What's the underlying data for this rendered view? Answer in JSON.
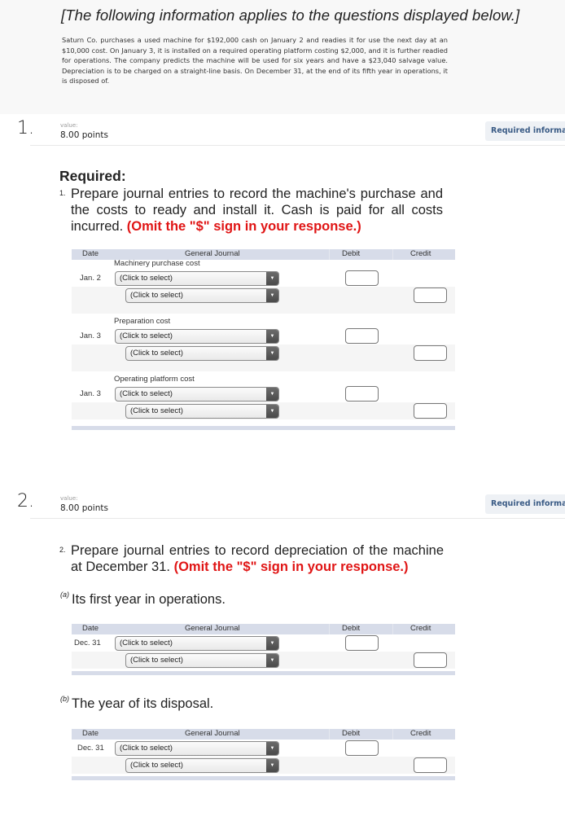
{
  "info": {
    "title": "[The following information applies to the questions displayed below.]",
    "text": "Saturn Co. purchases a used machine for $192,000 cash on January 2 and readies it for use the next day at an $10,000 cost. On January 3, it is installed on a required operating platform costing $2,000, and it is further readied for operations. The company predicts the machine will be used for six years and have a $23,040 salvage value. Depreciation is to be charged on a straight-line basis. On December 31, at the end of its fifth year in operations, it is disposed of."
  },
  "questions": [
    {
      "number": "1.",
      "value_label": "value:",
      "points": "8.00 points",
      "required_info_label": "Required information"
    },
    {
      "number": "2.",
      "value_label": "value:",
      "points": "8.00 points",
      "required_info_label": "Required information"
    }
  ],
  "q1": {
    "required_heading": "Required:",
    "prompt_num": "1.",
    "prompt_text": "Prepare journal entries to record the machine's purchase and the costs to ready and install it. Cash is paid for all costs incurred.",
    "prompt_red": "(Omit the \"$\" sign in your response.)",
    "table": {
      "headers": {
        "date": "Date",
        "journal": "General Journal",
        "debit": "Debit",
        "credit": "Credit"
      },
      "entries": [
        {
          "description": "Machinery purchase cost",
          "date": "Jan. 2",
          "debit_account": "(Click to select)",
          "credit_account": "(Click to select)",
          "debit_value": "",
          "credit_value": ""
        },
        {
          "description": "Preparation cost",
          "date": "Jan. 3",
          "debit_account": "(Click to select)",
          "credit_account": "(Click to select)",
          "debit_value": "",
          "credit_value": ""
        },
        {
          "description": "Operating platform cost",
          "date": "Jan. 3",
          "debit_account": "(Click to select)",
          "credit_account": "(Click to select)",
          "debit_value": "",
          "credit_value": ""
        }
      ]
    }
  },
  "q2": {
    "prompt_num": "2.",
    "prompt_text": "Prepare journal entries to record depreciation of the machine at December 31.",
    "prompt_red": "(Omit the \"$\" sign in your response.)",
    "part_a": {
      "marker": "(a)",
      "label": "Its first year in operations.",
      "table": {
        "headers": {
          "date": "Date",
          "journal": "General Journal",
          "debit": "Debit",
          "credit": "Credit"
        },
        "entry": {
          "date": "Dec. 31",
          "debit_account": "(Click to select)",
          "credit_account": "(Click to select)",
          "debit_value": "",
          "credit_value": ""
        }
      }
    },
    "part_b": {
      "marker": "(b)",
      "label": "The year of its disposal.",
      "table": {
        "headers": {
          "date": "Date",
          "journal": "General Journal",
          "debit": "Debit",
          "credit": "Credit"
        },
        "entry": {
          "date": "Dec. 31",
          "debit_account": "(Click to select)",
          "credit_account": "(Click to select)",
          "debit_value": "",
          "credit_value": ""
        }
      }
    }
  },
  "icons": {
    "dropdown_arrow": "▼"
  },
  "colors": {
    "accent_red": "#e01515",
    "header_band": "#d7dce9",
    "required_info_text": "#3a5b85"
  }
}
